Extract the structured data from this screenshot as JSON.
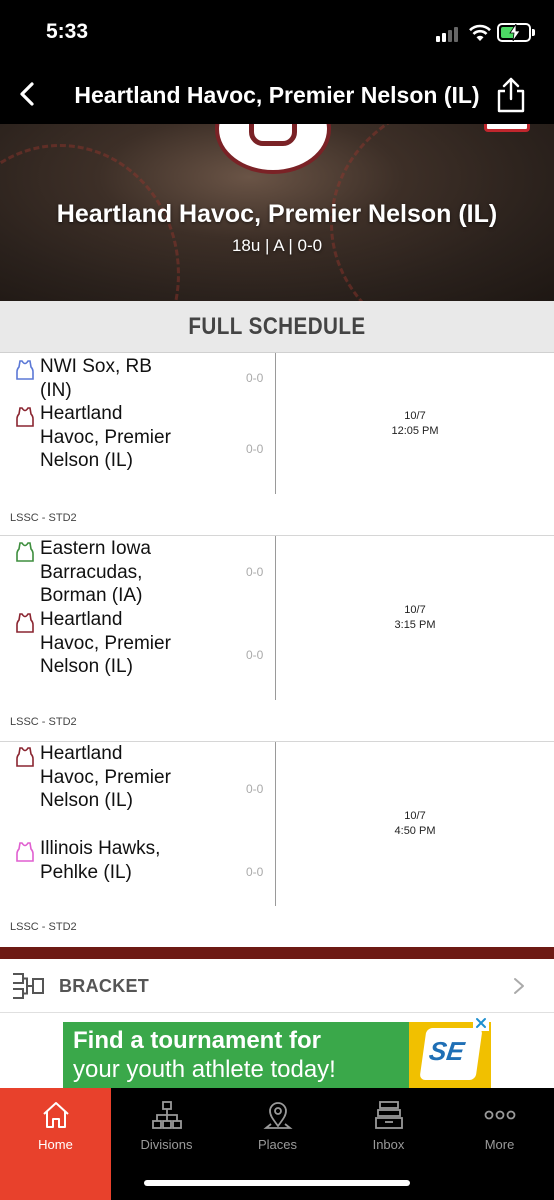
{
  "status_bar": {
    "time": "5:33"
  },
  "nav": {
    "title": "Heartland Havoc, Premier Nelson (IL)"
  },
  "hero": {
    "team_name": "Heartland Havoc, Premier Nelson (IL)",
    "subtitle": "18u | A | 0-0"
  },
  "schedule": {
    "section_title": "FULL SCHEDULE",
    "games": [
      {
        "team1": {
          "name": "NWI Sox, RB (IN)",
          "score": "0-0",
          "jersey_color": "#5b78d6"
        },
        "team2": {
          "name": "Heartland Havoc, Premier Nelson (IL)",
          "score": "0-0",
          "jersey_color": "#8a2530"
        },
        "date": "10/7",
        "time": "12:05 PM",
        "venue": "LSSC - STD2"
      },
      {
        "team1": {
          "name": "Eastern Iowa Barracudas, Borman (IA)",
          "score": "0-0",
          "jersey_color": "#3e8e3e"
        },
        "team2": {
          "name": "Heartland Havoc, Premier Nelson (IL)",
          "score": "0-0",
          "jersey_color": "#8a2530"
        },
        "date": "10/7",
        "time": "3:15 PM",
        "venue": "LSSC - STD2"
      },
      {
        "team1": {
          "name": "Heartland Havoc, Premier Nelson (IL)",
          "score": "0-0",
          "jersey_color": "#8a2530"
        },
        "team2": {
          "name": "Illinois Hawks, Pehlke (IL)",
          "score": "0-0",
          "jersey_color": "#e05fd0"
        },
        "date": "10/7",
        "time": "4:50 PM",
        "venue": "LSSC - STD2"
      }
    ]
  },
  "bracket": {
    "label": "BRACKET"
  },
  "ad": {
    "line1": "Find a tournament for",
    "line2": "your youth athlete today!",
    "logo_text": "SE"
  },
  "tabs": [
    {
      "label": "Home",
      "icon": "home-icon",
      "active": true
    },
    {
      "label": "Divisions",
      "icon": "divisions-icon",
      "active": false
    },
    {
      "label": "Places",
      "icon": "places-icon",
      "active": false
    },
    {
      "label": "Inbox",
      "icon": "inbox-icon",
      "active": false
    },
    {
      "label": "More",
      "icon": "more-icon",
      "active": false
    }
  ],
  "colors": {
    "accent": "#e8412c",
    "maroon": "#6d1a14",
    "ad_green": "#3aa84a",
    "ad_yellow": "#f1c000"
  }
}
